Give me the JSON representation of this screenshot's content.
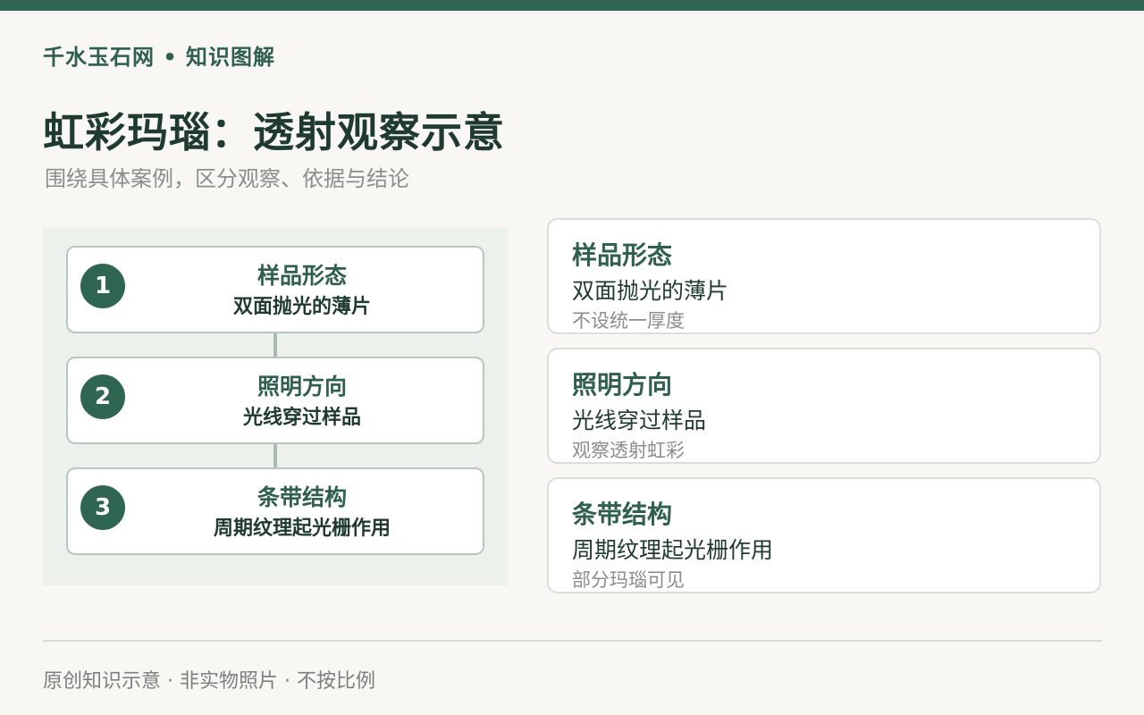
{
  "header": {
    "brand": "千水玉石网 • 知识图解",
    "title": "虹彩玛瑙：透射观察示意",
    "subtitle": "围绕具体案例，区分观察、依据与结论"
  },
  "flow": {
    "steps": [
      {
        "number": "1",
        "head": "样品形态",
        "body": "双面抛光的薄片"
      },
      {
        "number": "2",
        "head": "照明方向",
        "body": "光线穿过样品"
      },
      {
        "number": "3",
        "head": "条带结构",
        "body": "周期纹理起光栅作用"
      }
    ]
  },
  "cards": [
    {
      "head": "样品形态",
      "body": "双面抛光的薄片",
      "note": "不设统一厚度"
    },
    {
      "head": "照明方向",
      "body": "光线穿过样品",
      "note": "观察透射虹彩"
    },
    {
      "head": "条带结构",
      "body": "周期纹理起光栅作用",
      "note": "部分玛瑙可见"
    }
  ],
  "footer": {
    "text": "原创知识示意 · 非实物照片 · 不按比例"
  },
  "colors": {
    "accent": "#2f6652",
    "background": "#f8f7f3",
    "panel": "#edf1ec",
    "muted": "#8a8e8a"
  }
}
